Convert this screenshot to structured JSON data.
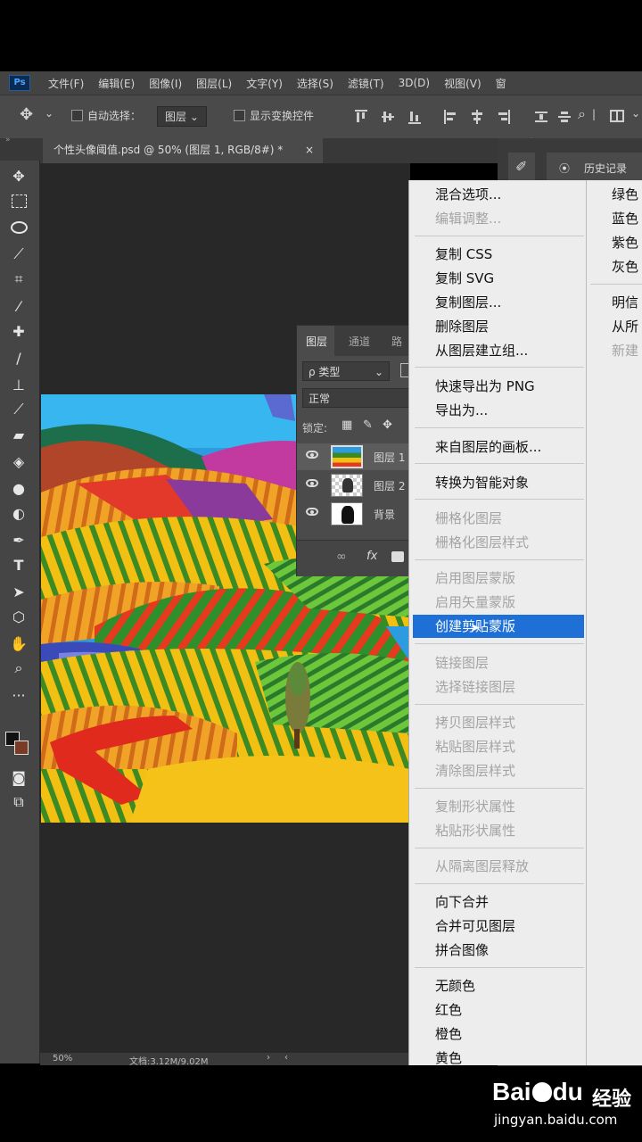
{
  "app": {
    "logo_text": "Ps",
    "menu": [
      "文件(F)",
      "编辑(E)",
      "图像(I)",
      "图层(L)",
      "文字(Y)",
      "选择(S)",
      "滤镜(T)",
      "3D(D)",
      "视图(V)",
      "窗"
    ]
  },
  "options_bar": {
    "auto_select_label": "自动选择：",
    "auto_select_value": "图层",
    "show_transform_label": "显示变换控件"
  },
  "document": {
    "tab_title": "个性头像阈值.psd @ 50% (图层 1, RGB/8#) *",
    "close": "×"
  },
  "status_bar": {
    "zoom": "50%",
    "doc_info": "文档:3.12M/9.02M"
  },
  "right_panel": {
    "history_label": "历史记录"
  },
  "layers_panel": {
    "tabs": [
      "图层",
      "通道",
      "路"
    ],
    "filter_label": "ρ 类型",
    "blend_mode": "正常",
    "lock_label": "锁定:",
    "layers": [
      {
        "name": "图层 1",
        "selected": true
      },
      {
        "name": "图层 2",
        "selected": false
      },
      {
        "name": "背景",
        "selected": false
      }
    ],
    "footer_icons": [
      "link-icon",
      "fx-icon",
      "mask-icon"
    ],
    "fx_label": "fx"
  },
  "context_menu": {
    "items": [
      {
        "label": "混合选项...",
        "enabled": true
      },
      {
        "label": "编辑调整...",
        "enabled": false
      },
      {
        "label": "复制 CSS",
        "enabled": true
      },
      {
        "label": "复制 SVG",
        "enabled": true
      },
      {
        "label": "复制图层...",
        "enabled": true
      },
      {
        "label": "删除图层",
        "enabled": true
      },
      {
        "label": "从图层建立组...",
        "enabled": true
      },
      {
        "label": "快速导出为 PNG",
        "enabled": true
      },
      {
        "label": "导出为...",
        "enabled": true
      },
      {
        "label": "来自图层的画板...",
        "enabled": true
      },
      {
        "label": "转换为智能对象",
        "enabled": true
      },
      {
        "label": "栅格化图层",
        "enabled": false
      },
      {
        "label": "栅格化图层样式",
        "enabled": false
      },
      {
        "label": "启用图层蒙版",
        "enabled": false
      },
      {
        "label": "启用矢量蒙版",
        "enabled": false
      },
      {
        "label": "创建剪贴蒙版",
        "enabled": true,
        "highlighted": true
      },
      {
        "label": "链接图层",
        "enabled": false
      },
      {
        "label": "选择链接图层",
        "enabled": false
      },
      {
        "label": "拷贝图层样式",
        "enabled": false
      },
      {
        "label": "粘贴图层样式",
        "enabled": false
      },
      {
        "label": "清除图层样式",
        "enabled": false
      },
      {
        "label": "复制形状属性",
        "enabled": false
      },
      {
        "label": "粘贴形状属性",
        "enabled": false
      },
      {
        "label": "从隔离图层释放",
        "enabled": false
      },
      {
        "label": "向下合并",
        "enabled": true
      },
      {
        "label": "合并可见图层",
        "enabled": true
      },
      {
        "label": "拼合图像",
        "enabled": true
      },
      {
        "label": "无颜色",
        "enabled": true
      },
      {
        "label": "红色",
        "enabled": true
      },
      {
        "label": "橙色",
        "enabled": true
      },
      {
        "label": "黄色",
        "enabled": true
      }
    ]
  },
  "sub_menu": {
    "items": [
      {
        "label": "绿色",
        "enabled": true
      },
      {
        "label": "蓝色",
        "enabled": true
      },
      {
        "label": "紫色",
        "enabled": true
      },
      {
        "label": "灰色",
        "enabled": true
      },
      {
        "label": "明信",
        "enabled": true
      },
      {
        "label": "从所",
        "enabled": true
      },
      {
        "label": "新建",
        "enabled": false
      }
    ]
  },
  "watermark": {
    "brand": "Bai",
    "brand2": "du",
    "cn": "经验",
    "url": "jingyan.baidu.com"
  },
  "colors": {
    "highlight": "#1e6fd6",
    "menu_bg": "#ededed",
    "ui_dark": "#454545"
  }
}
